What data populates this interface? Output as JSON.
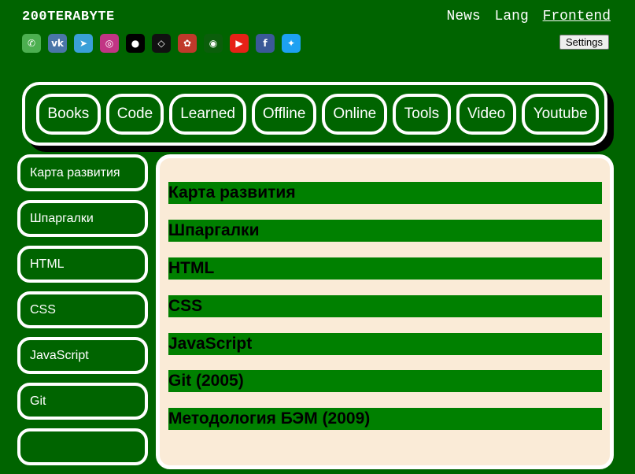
{
  "header": {
    "brand": "200TERABYTE",
    "links": [
      "News",
      "Lang",
      "Frontend"
    ],
    "settings_label": "Settings"
  },
  "socials": [
    {
      "icon": "whatsapp-icon",
      "glyph": "✆",
      "color": "#4caf50"
    },
    {
      "icon": "vk-icon",
      "glyph": "vk",
      "color": "#4a76a8"
    },
    {
      "icon": "telegram-icon",
      "glyph": "➤",
      "color": "#3aa0d8"
    },
    {
      "icon": "instagram-icon",
      "glyph": "◎",
      "color": "#c13584"
    },
    {
      "icon": "github-icon",
      "glyph": "●",
      "color": "#000000"
    },
    {
      "icon": "codepen-icon",
      "glyph": "◇",
      "color": "#111111"
    },
    {
      "icon": "spiral-icon",
      "glyph": "✿",
      "color": "#c0392b"
    },
    {
      "icon": "circle-logo-icon",
      "glyph": "◉",
      "color": "#0b5e0b"
    },
    {
      "icon": "youtube-icon",
      "glyph": "▶",
      "color": "#e62117"
    },
    {
      "icon": "facebook-icon",
      "glyph": "f",
      "color": "#3b5998"
    },
    {
      "icon": "twitter-icon",
      "glyph": "✦",
      "color": "#1da1f2"
    }
  ],
  "nav": {
    "items": [
      "Books",
      "Code",
      "Learned",
      "Offline",
      "Online",
      "Tools",
      "Video",
      "Youtube"
    ]
  },
  "sidebar": {
    "items": [
      "Карта развития",
      "Шпаргалки",
      "HTML",
      "CSS",
      "JavaScript",
      "Git",
      ""
    ]
  },
  "main": {
    "sections": [
      "Карта развития",
      "Шпаргалки",
      "HTML",
      "CSS",
      "JavaScript",
      "Git (2005)",
      "Методология БЭМ (2009)"
    ]
  },
  "colors": {
    "background": "#006400",
    "section_bar": "#008000",
    "panel": "#faebd7"
  }
}
